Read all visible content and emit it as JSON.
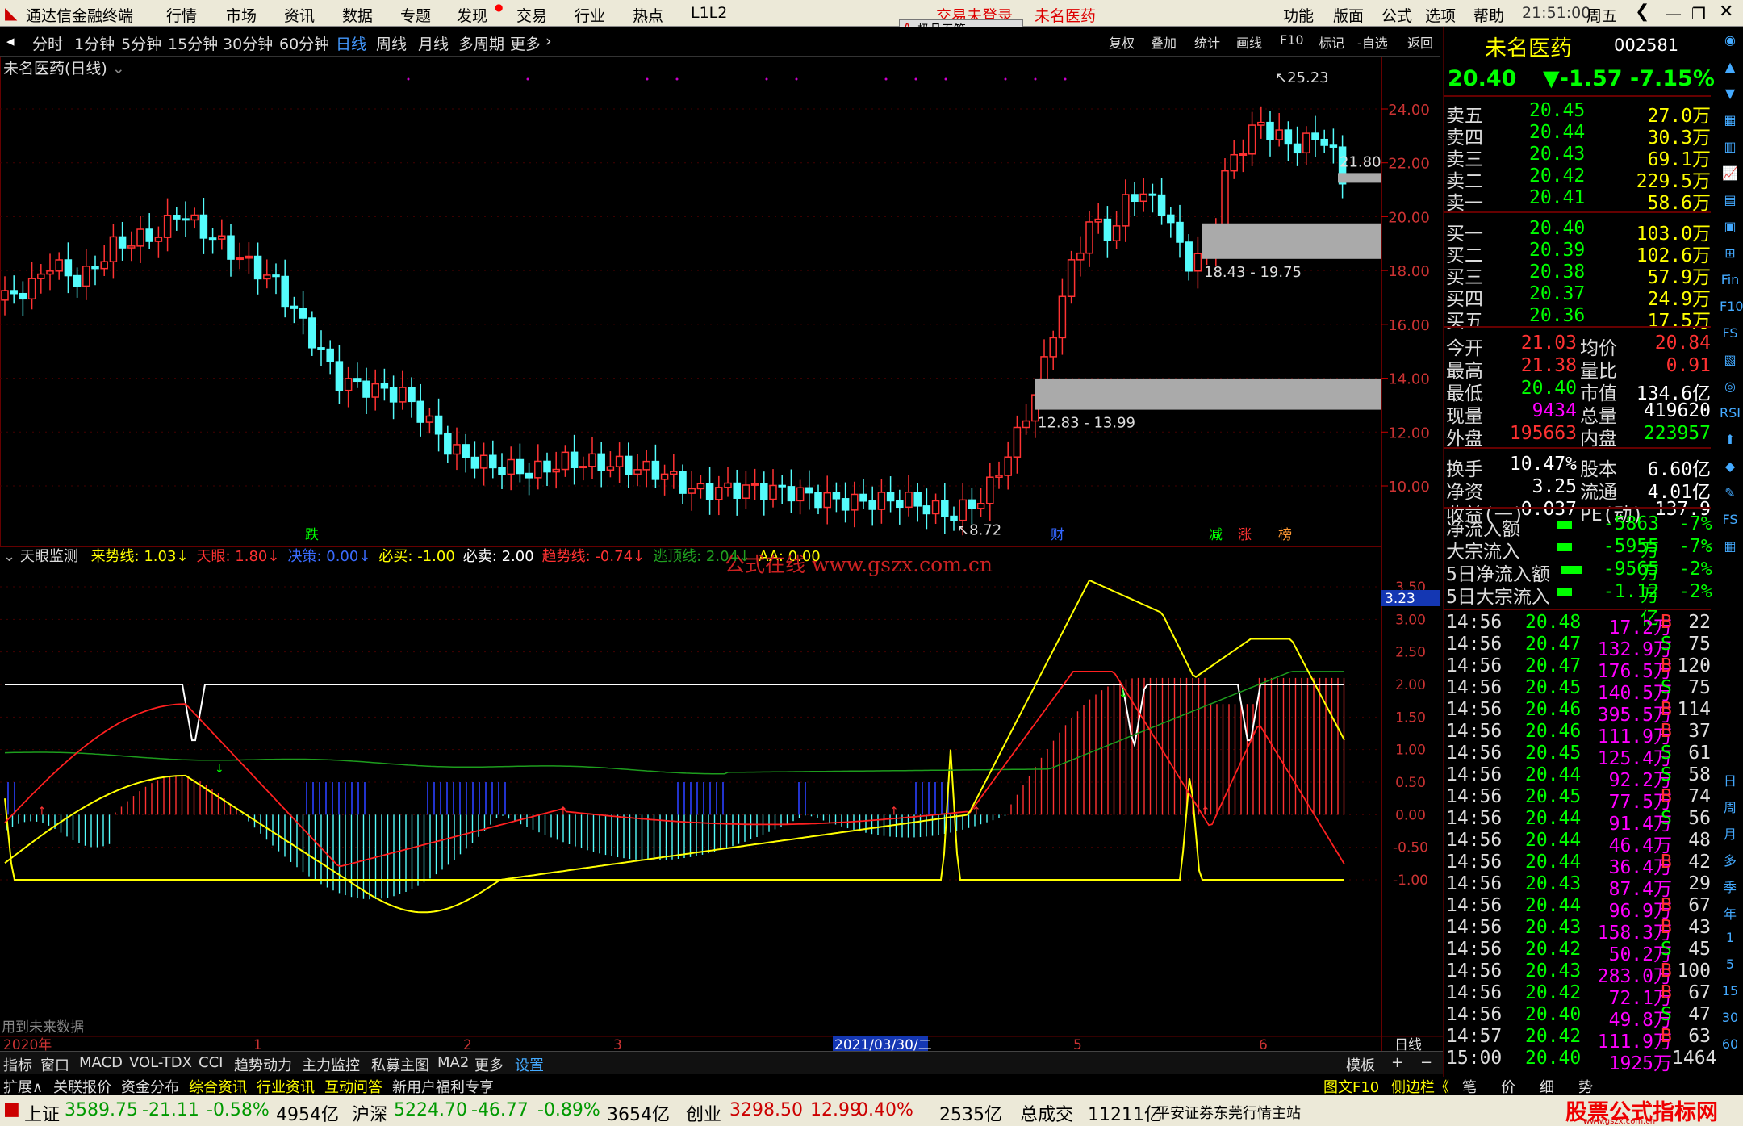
{
  "app": {
    "title": "通达信金融终端",
    "menu": [
      "行情",
      "市场",
      "资讯",
      "数据",
      "专题",
      "发现",
      "交易",
      "行业",
      "热点",
      "L1L2"
    ],
    "right_menu": [
      "功能",
      "版面",
      "公式",
      "选项",
      "帮助"
    ],
    "notice": "交易未登录",
    "stock_name_top": "未名医药",
    "time": "21:51:00",
    "weekday": "周五",
    "wudang": "极品五笔"
  },
  "periods": [
    "分时",
    "1分钟",
    "5分钟",
    "15分钟",
    "30分钟",
    "60分钟",
    "日线",
    "周线",
    "月线",
    "多周期",
    "更多"
  ],
  "period_active": "日线",
  "tools": [
    "复权",
    "叠加",
    "统计",
    "画线",
    "F10",
    "标记",
    "-自选",
    "返回"
  ],
  "chart": {
    "title": "未名医药(日线)",
    "price_ticks": [
      "24.00",
      "22.00",
      "20.00",
      "18.00",
      "16.00",
      "14.00",
      "12.00",
      "10.00"
    ],
    "high_label": "25.23",
    "low_label": "8.72",
    "last_label": "21.80",
    "gap1": "18.43 - 19.75",
    "gap2": "12.83 - 13.99",
    "marks": [
      {
        "text": "跌"
      },
      {
        "text": "财"
      },
      {
        "text": "减"
      },
      {
        "text": "涨"
      },
      {
        "text": "榜"
      }
    ]
  },
  "indicator": {
    "name": "天眼监测",
    "params": [
      {
        "label": "来势线:",
        "value": "1.03",
        "color": "#ffff00"
      },
      {
        "label": "天眼:",
        "value": "1.80",
        "color": "#ff3232"
      },
      {
        "label": "决策:",
        "value": "0.00",
        "color": "#3a6cff"
      },
      {
        "label": "必买:",
        "value": "-1.00",
        "color": "#ffff00"
      },
      {
        "label": "必卖:",
        "value": "2.00",
        "color": "#ffffff"
      },
      {
        "label": "趋势线:",
        "value": "-0.74",
        "color": "#ff3232"
      },
      {
        "label": "逃顶线:",
        "value": "2.04",
        "color": "#20a020"
      },
      {
        "label": "AA:",
        "value": "0.00",
        "color": "#ffff00"
      }
    ],
    "watermark": "公式在线 www.gszx.com.cn",
    "ticks": [
      "3.50",
      "3.00",
      "2.50",
      "2.00",
      "1.50",
      "1.00",
      "0.50",
      "0.00",
      "-0.50",
      "-1.00"
    ],
    "cur": "3.23",
    "footnote": "用到未来数据"
  },
  "xaxis": {
    "labels": [
      "2020年",
      "1",
      "2",
      "3",
      "2021/03/30/二",
      "5",
      "6"
    ],
    "right": "日线"
  },
  "quote": {
    "name": "未名医药",
    "code": "002581",
    "price": "20.40",
    "change": "-1.57",
    "pct": "-7.15%",
    "sell": [
      [
        "卖五",
        "20.45",
        "27.0万"
      ],
      [
        "卖四",
        "20.44",
        "30.3万"
      ],
      [
        "卖三",
        "20.43",
        "69.1万"
      ],
      [
        "卖二",
        "20.42",
        "229.5万"
      ],
      [
        "卖一",
        "20.41",
        "58.6万"
      ]
    ],
    "buy": [
      [
        "买一",
        "20.40",
        "103.0万"
      ],
      [
        "买二",
        "20.39",
        "102.6万"
      ],
      [
        "买三",
        "20.38",
        "57.9万"
      ],
      [
        "买四",
        "20.37",
        "24.9万"
      ],
      [
        "买五",
        "20.36",
        "17.5万"
      ]
    ],
    "stats": [
      [
        "今开",
        "21.03",
        "均价",
        "20.84"
      ],
      [
        "最高",
        "21.38",
        "量比",
        "0.91"
      ],
      [
        "最低",
        "20.40",
        "市值",
        "134.6亿"
      ],
      [
        "现量",
        "9434",
        "总量",
        "419620"
      ],
      [
        "外盘",
        "195663",
        "内盘",
        "223957"
      ]
    ],
    "stats2": [
      [
        "换手",
        "10.47%",
        "股本",
        "6.60亿"
      ],
      [
        "净资",
        "3.25",
        "流通",
        "4.01亿"
      ],
      [
        "收益(一)",
        "0.037",
        "PE(动)",
        "137.9"
      ]
    ],
    "flows": [
      [
        "净流入额",
        "-5863万",
        "-7%"
      ],
      [
        "大宗流入",
        "-5955万",
        "-7%"
      ],
      [
        "5日净流入额",
        "-9565万",
        "-2%"
      ],
      [
        "5日大宗流入",
        "-1.12亿",
        "-2%"
      ]
    ],
    "ticks": [
      [
        "14:56",
        "20.48",
        "17.2万",
        "B",
        "22"
      ],
      [
        "14:56",
        "20.47",
        "132.9万",
        "S",
        "75"
      ],
      [
        "14:56",
        "20.47",
        "176.5万",
        "B",
        "120"
      ],
      [
        "14:56",
        "20.45",
        "140.5万",
        "S",
        "75"
      ],
      [
        "14:56",
        "20.46",
        "395.5万",
        "B",
        "114"
      ],
      [
        "14:56",
        "20.46",
        "111.9万",
        "B",
        "37"
      ],
      [
        "14:56",
        "20.45",
        "125.4万",
        "S",
        "61"
      ],
      [
        "14:56",
        "20.44",
        "92.2万",
        "S",
        "58"
      ],
      [
        "14:56",
        "20.45",
        "77.5万",
        "B",
        "74"
      ],
      [
        "14:56",
        "20.44",
        "91.4万",
        "S",
        "56"
      ],
      [
        "14:56",
        "20.44",
        "46.4万",
        "",
        "48"
      ],
      [
        "14:56",
        "20.44",
        "36.4万",
        "B",
        "42"
      ],
      [
        "14:56",
        "20.43",
        "87.4万",
        "",
        "29"
      ],
      [
        "14:56",
        "20.44",
        "96.9万",
        "B",
        "67"
      ],
      [
        "14:56",
        "20.43",
        "158.3万",
        "B",
        "43"
      ],
      [
        "14:56",
        "20.42",
        "50.2万",
        "S",
        "45"
      ],
      [
        "14:56",
        "20.43",
        "283.0万",
        "B",
        "100"
      ],
      [
        "14:56",
        "20.42",
        "72.1万",
        "B",
        "67"
      ],
      [
        "14:56",
        "20.40",
        "49.8万",
        "S",
        "47"
      ],
      [
        "14:57",
        "20.42",
        "111.9万",
        "B",
        "63"
      ],
      [
        "15:00",
        "20.40",
        "1925万",
        "",
        "1464"
      ]
    ]
  },
  "bottom_tabs": [
    "指标",
    "窗口",
    "MACD",
    "VOL-TDX",
    "CCI",
    "趋势动力",
    "主力监控",
    "私募主图",
    "MA2",
    "更多",
    "设置"
  ],
  "bottom_right": [
    "模板",
    "+",
    "−"
  ],
  "bottom_tabs2": [
    "扩展∧",
    "关联报价",
    "资金分布",
    "综合资讯",
    "行业资讯",
    "互动问答",
    "新用户福利专享"
  ],
  "bottom_tabs2_right": [
    "图文F10",
    "侧边栏《",
    "笔",
    "价",
    "细",
    "势"
  ],
  "status": {
    "sh_label": "上证",
    "sh": "3589.75",
    "sh_chg": "-21.11",
    "sh_pct": "-0.58%",
    "sh_amt": "4954亿",
    "sz_label": "沪深",
    "sz": "5224.70",
    "sz_chg": "-46.77",
    "sz_pct": "-0.89%",
    "sz_amt": "3654亿",
    "cy_label": "创业",
    "cy": "3298.50",
    "cy_chg": "12.99",
    "cy_pct": "0.40%",
    "cy_amt": "2535亿",
    "total_label": "总成交",
    "total": "11211亿",
    "broker": "平安证券东莞行情主站",
    "brand": "股票公式指标网",
    "brand_url": "www.gszx.com.cn"
  },
  "sidebar_items": [
    "日",
    "周",
    "月",
    "多",
    "季",
    "年",
    "1",
    "5",
    "15",
    "30",
    "60"
  ]
}
